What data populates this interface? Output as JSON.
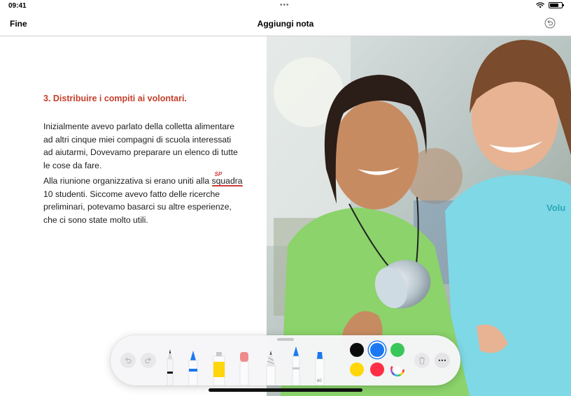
{
  "status_bar": {
    "time": "09:41",
    "dots": "•••",
    "wifi_icon": "wifi-icon",
    "battery_icon": "battery-icon",
    "battery_level": 0.78
  },
  "nav": {
    "done_label": "Fine",
    "title": "Aggiungi nota",
    "undo_icon": "undo-circle-icon"
  },
  "document": {
    "heading": "3. Distribuire i compiti ai volontari.",
    "paragraph1": "Inizialmente avevo parlato della colletta alimentare ad altri cinque miei compagni di scuola interessati ad aiutarmi, Dovevamo preparare un elenco di tutte le cose da fare.",
    "paragraph2_before": "Alla riunione organizzativa si erano uniti alla ",
    "paragraph2_flagged_word": "squadra",
    "paragraph2_after": " 10 studenti. Siccome avevo fatto delle ricerche preliminari, potevamo basarci su altre esperienze, che ci sono state molto utili.",
    "spell_mark": "SP"
  },
  "photo": {
    "shirt_text": "Volu"
  },
  "toolbar": {
    "undo_icon": "undo-icon",
    "redo_icon": "redo-icon",
    "tools": [
      "pen",
      "marker",
      "highlighter",
      "eraser",
      "pencil",
      "fountain-pen",
      "watercolor-brush"
    ],
    "brush_label": "80",
    "colors": [
      "#0b0b0b",
      "#1b78f2",
      "#39c759",
      "#ffd60a",
      "#ff2d45"
    ],
    "selected_color": "#1b78f2",
    "color_picker_icon": "color-wheel-icon",
    "trash_icon": "trash-icon",
    "more_icon": "more-icon"
  }
}
